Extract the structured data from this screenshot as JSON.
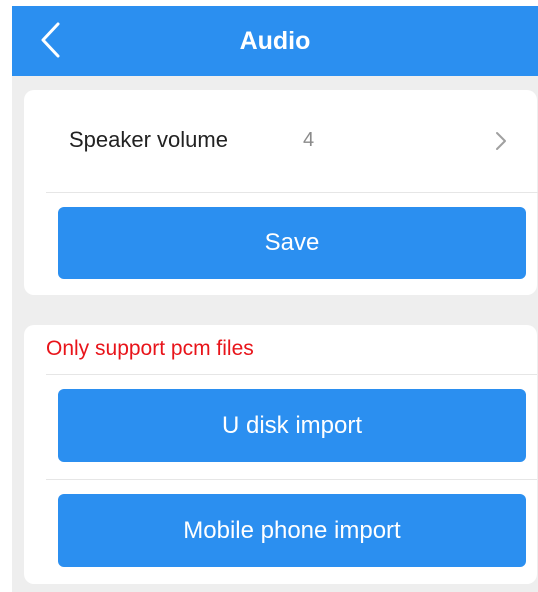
{
  "header": {
    "title": "Audio",
    "back_icon": "chevron-left-icon"
  },
  "settings": {
    "speaker_volume_label": "Speaker volume",
    "speaker_volume_value": "4",
    "row_icon": "chevron-right-icon",
    "save_label": "Save"
  },
  "import": {
    "notice": "Only support pcm files",
    "u_disk_label": "U disk import",
    "mobile_label": "Mobile phone import"
  },
  "colors": {
    "accent": "#2b8ff0",
    "notice": "#e8141a",
    "background": "#eeeeee"
  }
}
